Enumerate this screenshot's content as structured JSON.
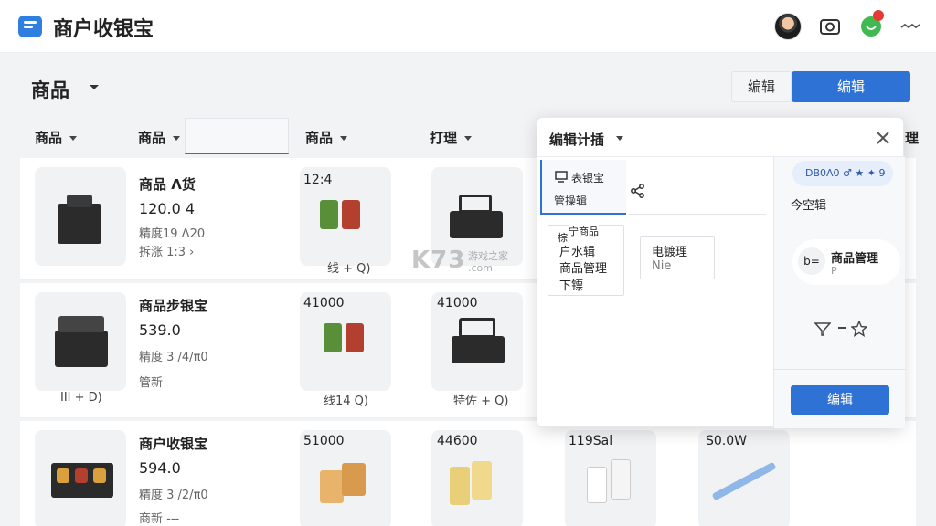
{
  "app": {
    "title": "商户收银宝"
  },
  "page": {
    "title": "商品"
  },
  "toolbar": {
    "secondary_label": "编辑",
    "primary_label": "编辑"
  },
  "filters": [
    "商品",
    "商品",
    "商品",
    "打理"
  ],
  "filter_cut": "理",
  "rows": [
    {
      "name": "商品 Λ货",
      "price": "120.0 4",
      "meta1": "精度19 Λ20",
      "meta2": "拆涨 1:3 ›",
      "col2_top": "12:4",
      "col2_caption": "线 + Q)"
    },
    {
      "name": "商品步银宝",
      "price": "539.0",
      "meta1": "精度 3 /4/π0",
      "meta2": "管新",
      "thumb_caption": "ΙΙΙ + D)",
      "col2_top": "41000",
      "col2_caption": "线14 Q)",
      "col3_top": "41000",
      "col3_caption": "特佐 + Q)"
    },
    {
      "name": "商户收银宝",
      "price": "594.0",
      "meta1": "精度 3 /2/π0",
      "meta2": "商新 ---",
      "col2_top": "51000",
      "col3_top": "44600",
      "col4_top": "119Sal",
      "col5_top": "S0.0W"
    }
  ],
  "popover": {
    "title": "编辑计插",
    "tab_label": "表银宝",
    "tab_sub": "管操辑",
    "card1": {
      "header": "宁商品",
      "line1": "棕",
      "line2": "户水辑",
      "line3": "商品管理",
      "line4": "下镖"
    },
    "card2": {
      "line1": "电镀理",
      "line2": "Nie"
    },
    "chip": "DB0Λ0 ♂ ★ ✦ 9",
    "subtitle": "今空辑",
    "item": {
      "icon_text": "b=",
      "label": "商品管理",
      "sub": "P"
    },
    "button": "编辑"
  },
  "watermark": {
    "main": "K73",
    "sub1": "游戏之家",
    "sub2": ".com"
  }
}
